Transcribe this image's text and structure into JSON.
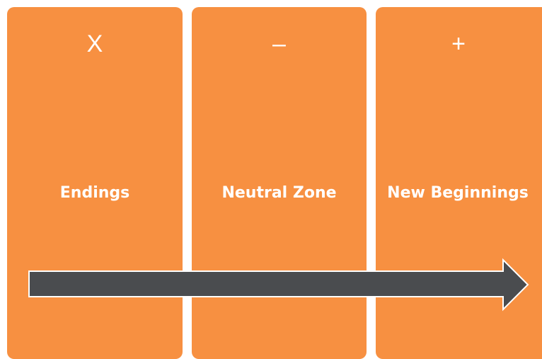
{
  "stages": [
    {
      "symbol": "X",
      "label": "Endings"
    },
    {
      "symbol": "–",
      "label": "Neutral Zone"
    },
    {
      "symbol": "+",
      "label": "New Beginnings"
    }
  ],
  "colors": {
    "panel": "#f79041",
    "arrow_fill": "#4a4c4f",
    "arrow_stroke": "#ffffff",
    "text": "#ffffff"
  },
  "icons": {
    "arrow": "right-arrow-icon"
  }
}
